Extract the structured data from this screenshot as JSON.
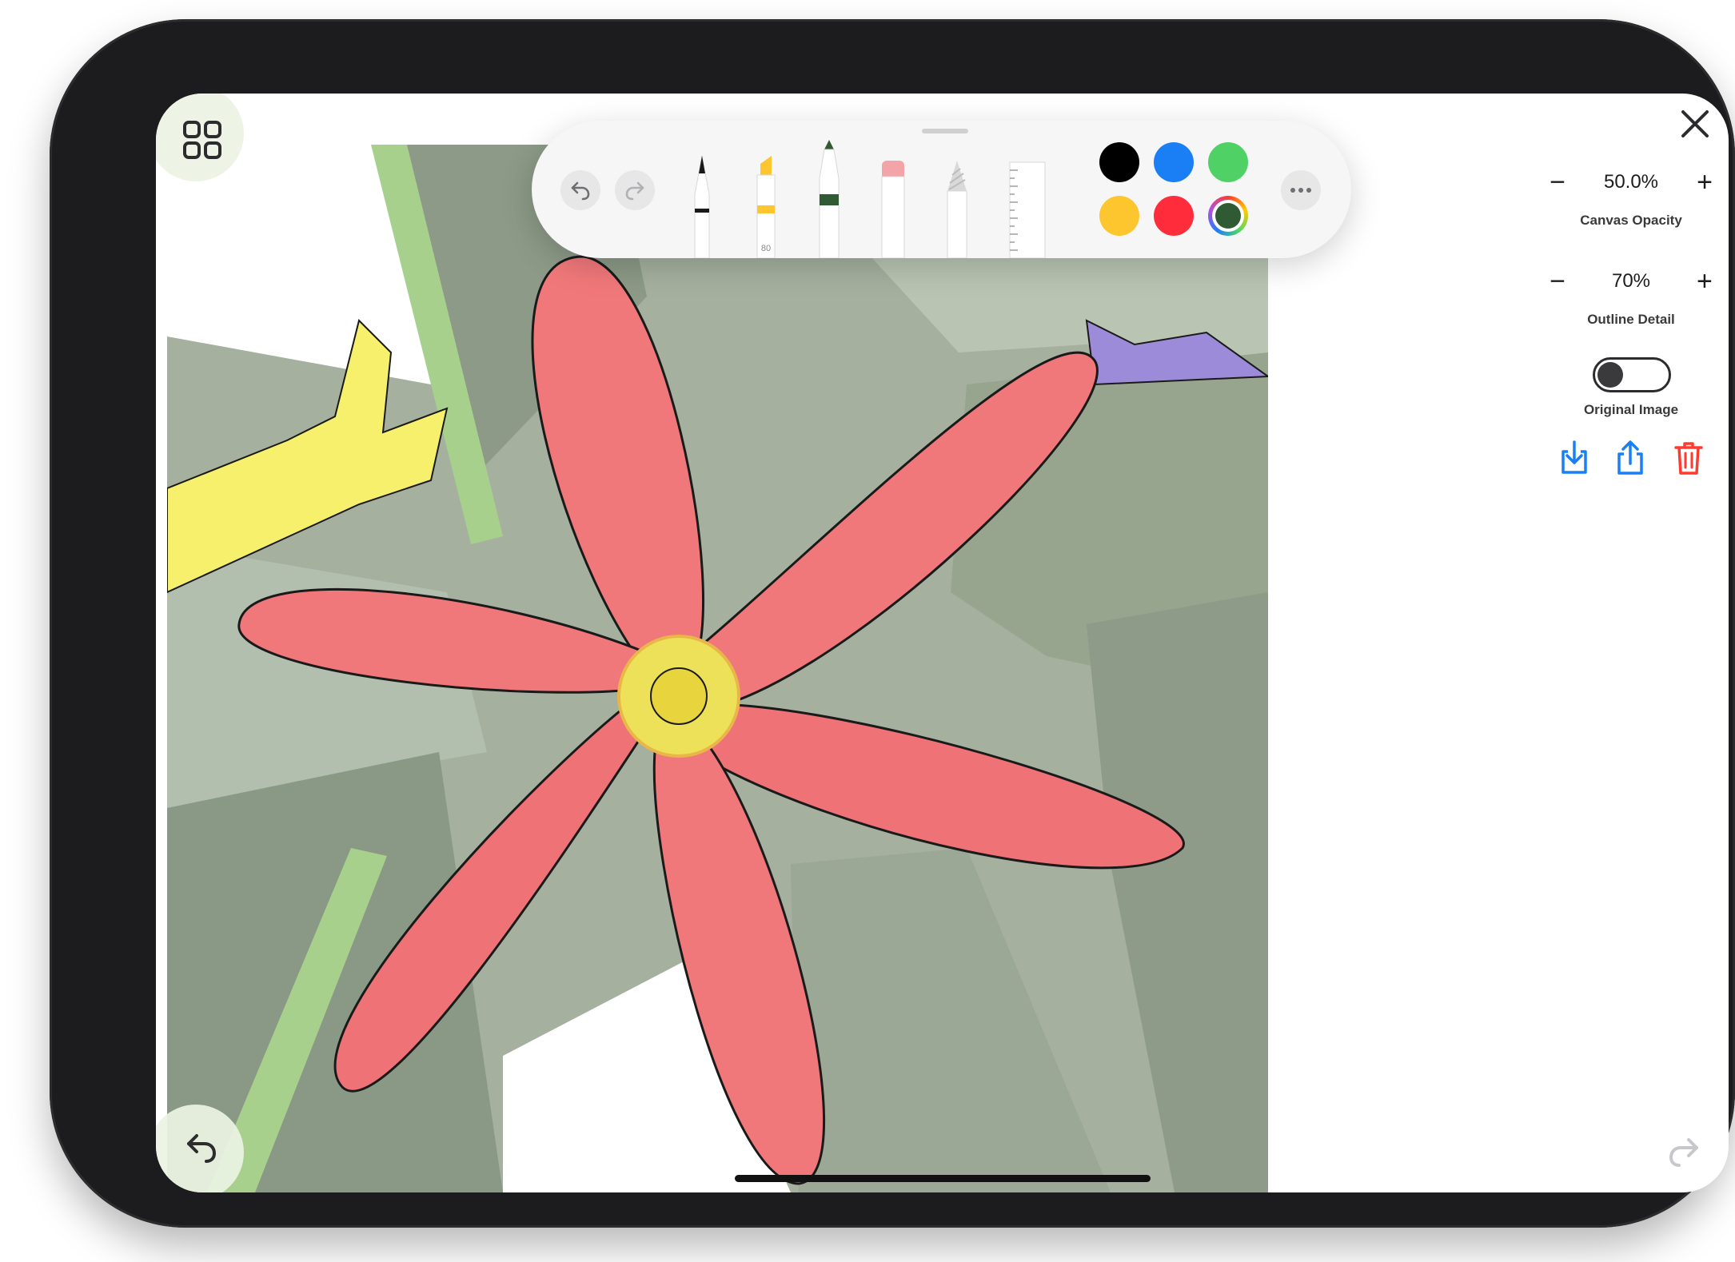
{
  "device": {
    "frame_color": "#1c1c1e"
  },
  "toolbar": {
    "undo_icon": "undo-arrow-icon",
    "redo_icon": "redo-arrow-icon",
    "more_icon": "ellipsis-icon",
    "tools": [
      {
        "name": "pen",
        "selected": false
      },
      {
        "name": "highlighter",
        "width_label": "80",
        "selected": false
      },
      {
        "name": "marker",
        "selected": true
      },
      {
        "name": "eraser",
        "selected": false
      },
      {
        "name": "pencil",
        "selected": false
      },
      {
        "name": "ruler",
        "selected": false
      }
    ],
    "colors": {
      "black": "#000000",
      "blue": "#1a7ef5",
      "green": "#4fd166",
      "yellow": "#fec62e",
      "red": "#ff2d3c",
      "current": "#2f5a33"
    }
  },
  "controls": {
    "canvas_opacity": {
      "minus": "−",
      "value": "50.0%",
      "plus": "+",
      "label": "Canvas Opacity"
    },
    "outline_detail": {
      "minus": "−",
      "value": "70%",
      "plus": "+",
      "label": "Outline Detail"
    },
    "original_image": {
      "label": "Original Image",
      "on": false
    }
  },
  "actions": {
    "download": "download-icon",
    "share": "share-icon",
    "delete": "trash-icon"
  },
  "artwork": {
    "palette": {
      "petal": "#f1787a",
      "petal_shade": "#e9696b",
      "center": "#eee15a",
      "leaf_dark": "#8c9a87",
      "leaf_mid": "#a5b09f",
      "leaf_light": "#b9c4b2",
      "stem": "#a8d08d",
      "yellow_flower": "#f7f06d",
      "violet": "#9c8bd8",
      "outline": "#1a1a1a"
    }
  }
}
